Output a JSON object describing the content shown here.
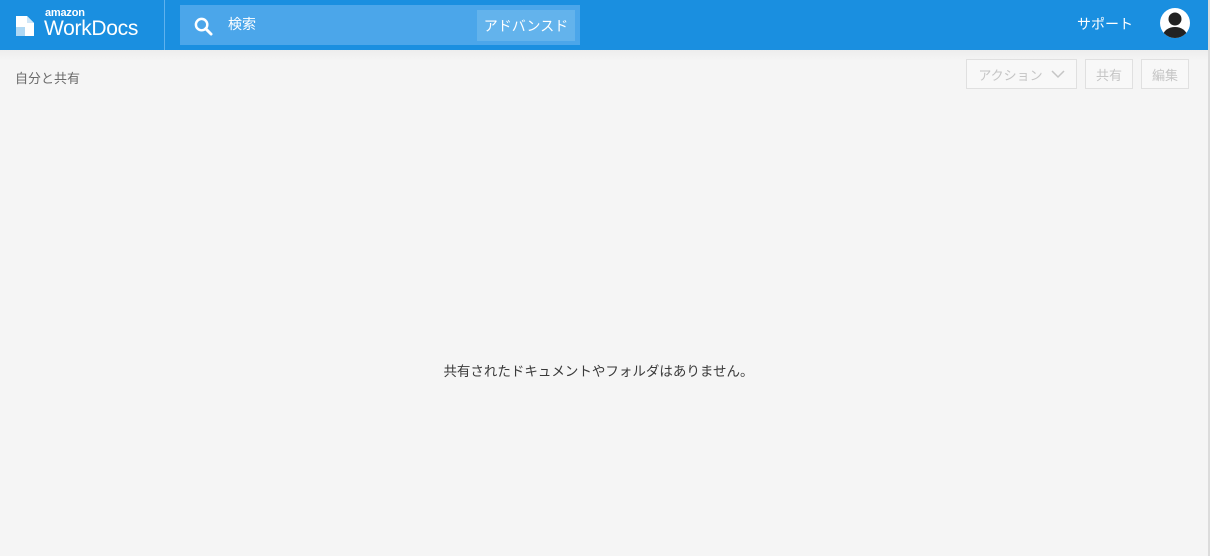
{
  "header": {
    "logo": {
      "brand": "amazon",
      "product": "WorkDocs"
    },
    "search": {
      "placeholder": "検索",
      "advanced_label": "アドバンスド"
    },
    "support_label": "サポート",
    "avatar_icon": "user-avatar-icon",
    "colors": {
      "bar": "#1a8fe0",
      "search": "#4ba6ea",
      "advanced": "#63b3ec"
    }
  },
  "toolbar": {
    "breadcrumb": "自分と共有",
    "actions_label": "アクション",
    "actions_icon": "chevron-down-icon",
    "share_label": "共有",
    "edit_label": "編集"
  },
  "main": {
    "empty_message": "共有されたドキュメントやフォルダはありません。"
  }
}
